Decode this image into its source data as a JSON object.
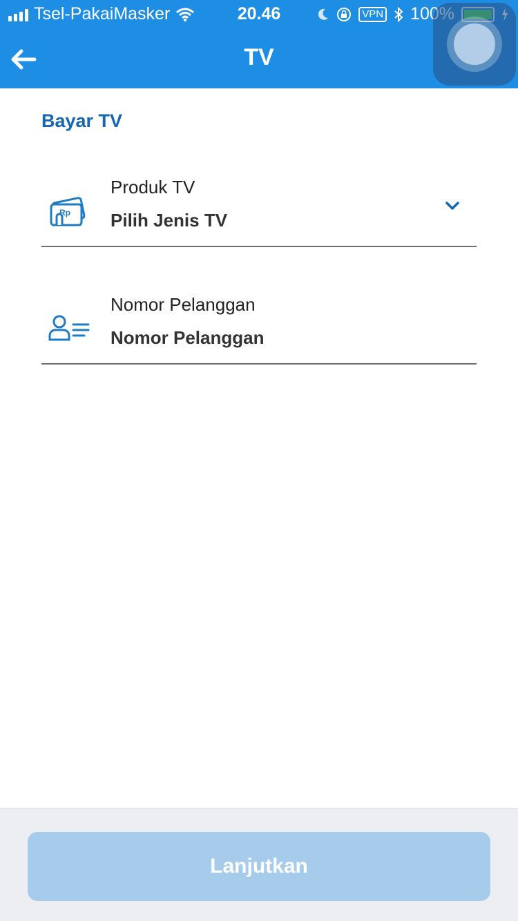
{
  "status_bar": {
    "carrier": "Tsel-PakaiMasker",
    "time": "20.46",
    "vpn": "VPN",
    "battery": "100%",
    "icons": [
      "signal-icon",
      "wifi-icon",
      "moon-icon",
      "rotation-lock-icon",
      "bluetooth-icon",
      "battery-icon",
      "charging-icon"
    ]
  },
  "header": {
    "title": "TV",
    "back_icon": "arrow-left-icon"
  },
  "section": {
    "title": "Bayar TV"
  },
  "form": {
    "product": {
      "label": "Produk TV",
      "value": "Pilih Jenis TV",
      "icon": "wallet-rp-icon"
    },
    "customer_number": {
      "label": "Nomor Pelanggan",
      "placeholder": "Nomor Pelanggan",
      "icon": "customer-id-icon"
    }
  },
  "footer": {
    "continue_label": "Lanjutkan"
  },
  "colors": {
    "primary": "#1e8de4",
    "section_title": "#1565b0",
    "button_disabled": "#a7cbea"
  }
}
